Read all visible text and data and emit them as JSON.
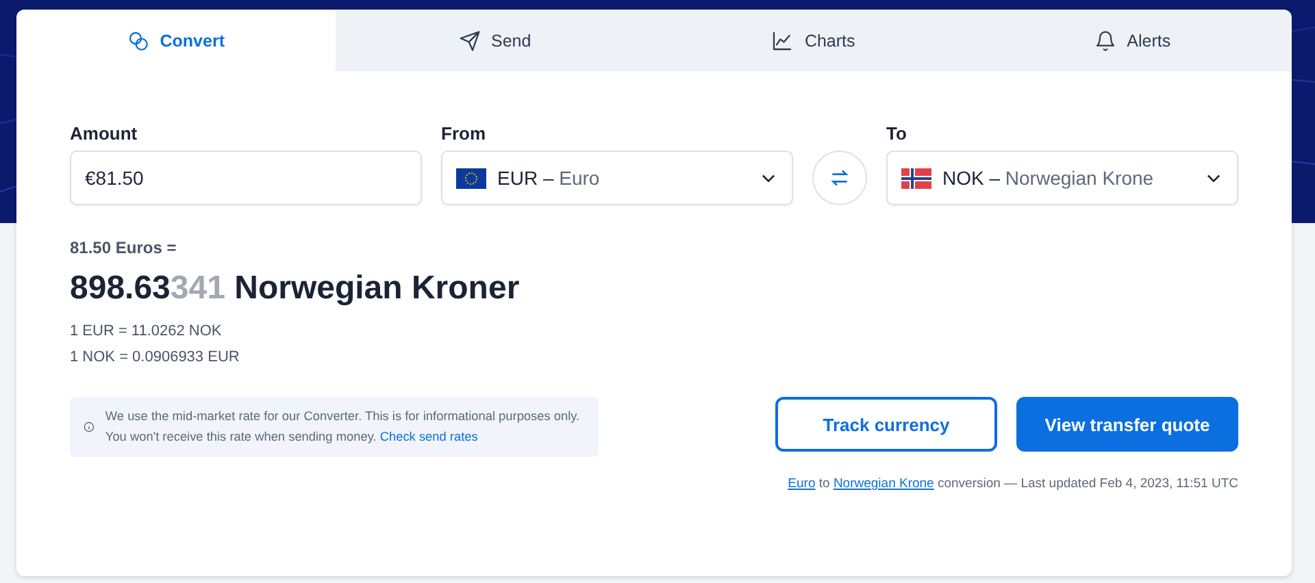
{
  "tabs": [
    {
      "label": "Convert",
      "kind": "coins",
      "selected": true
    },
    {
      "label": "Send",
      "kind": "send",
      "selected": false
    },
    {
      "label": "Charts",
      "kind": "chart",
      "selected": false
    },
    {
      "label": "Alerts",
      "kind": "bell",
      "selected": false
    }
  ],
  "amount": {
    "label": "Amount",
    "value": "€81.50"
  },
  "from": {
    "label": "From",
    "code": "EUR – ",
    "name": "Euro",
    "kind": "eu"
  },
  "to": {
    "label": "To",
    "code": "NOK – ",
    "name": "Norwegian Krone",
    "kind": "no"
  },
  "result": {
    "source": "81.50 Euros =",
    "whole": "898.63",
    "faded": "341",
    "unit": " Norwegian Kroner",
    "rates": [
      "1 EUR = 11.0262 NOK",
      "1 NOK = 0.0906933 EUR"
    ]
  },
  "note": {
    "text": "We use the mid-market rate for our Converter. This is for informational purposes only. You won't receive this rate when sending money. ",
    "link": "Check send rates"
  },
  "buttons": [
    {
      "label": "Track currency",
      "kind": "outline"
    },
    {
      "label": "View transfer quote",
      "kind": "primary"
    }
  ],
  "footer": {
    "link_from": "Euro",
    "joiner": " to ",
    "link_to": "Norwegian Krone",
    "rest": " conversion — Last updated Feb 4, 2023, 11:51 UTC"
  }
}
